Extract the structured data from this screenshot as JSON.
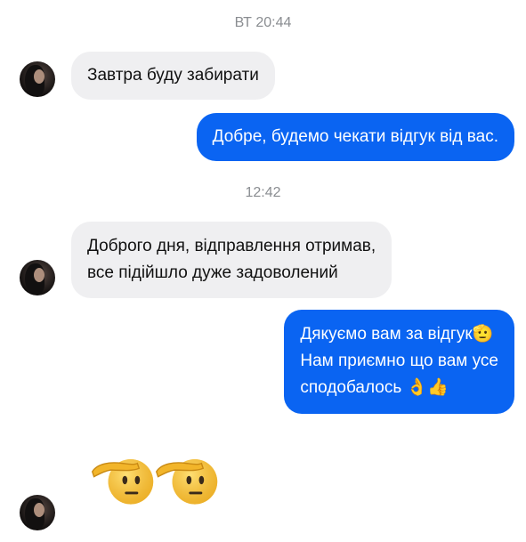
{
  "timestamps": {
    "first": "ВТ 20:44",
    "second": "12:42"
  },
  "messages": [
    {
      "side": "incoming",
      "lines": [
        "Завтра буду забирати"
      ]
    },
    {
      "side": "outgoing",
      "lines": [
        "Добре, будемо чекати відгук від вас."
      ]
    },
    {
      "side": "incoming",
      "lines": [
        "Доброго дня, відправлення отримав,",
        "все підійшло дуже задоволений"
      ]
    },
    {
      "side": "outgoing",
      "lines": [
        "Дякуємо вам за відгук🫡",
        "Нам приємно що вам усе",
        "сподобалось 👌👍"
      ]
    }
  ],
  "emoji_message": {
    "icon_names": [
      "saluting-face-icon",
      "saluting-face-icon"
    ]
  },
  "colors": {
    "incoming_bubble": "#efeff1",
    "outgoing_bubble": "#0a64f2",
    "timestamp_text": "#8a8d91"
  }
}
